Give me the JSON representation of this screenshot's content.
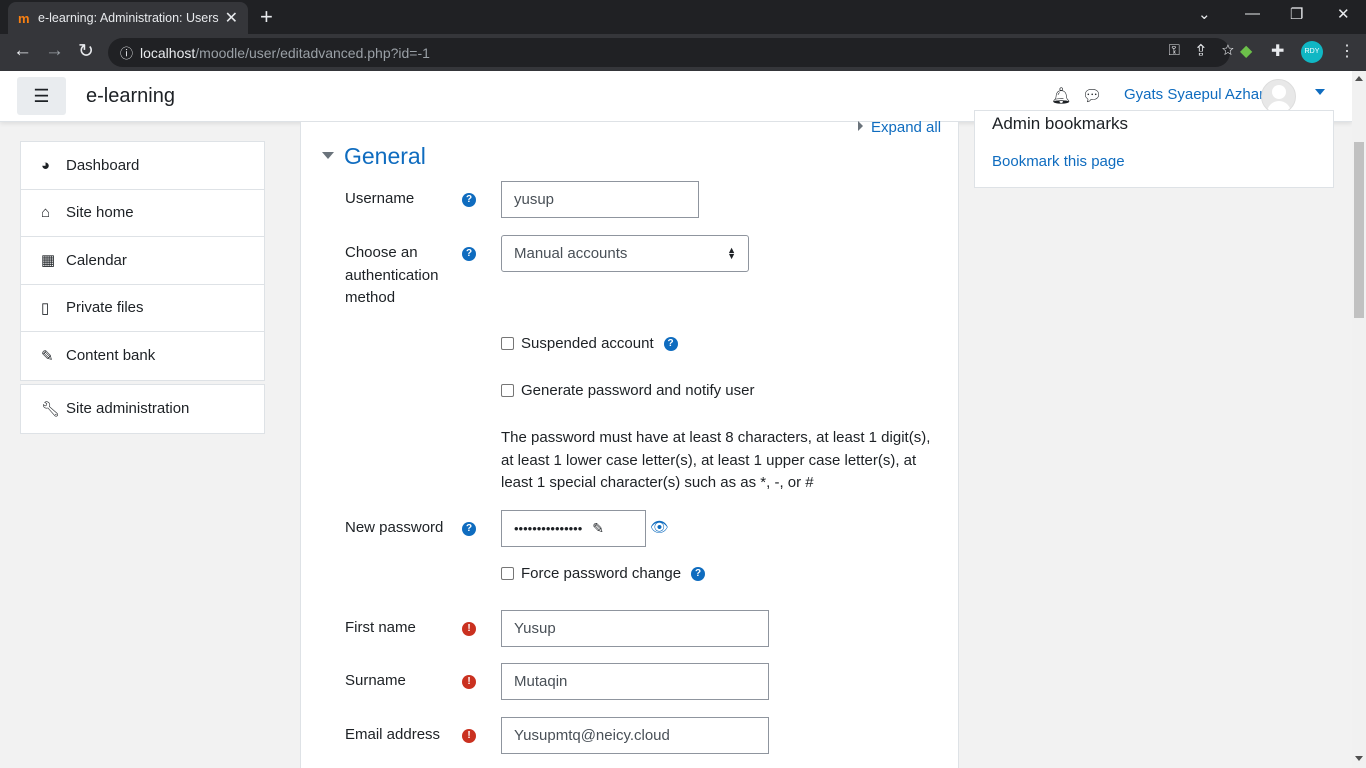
{
  "browser": {
    "tab_title": "e-learning: Administration: Users",
    "tab_favicon": "moodle-icon",
    "url_host": "localhost",
    "url_path": "/moodle/user/editadvanced.php?id=-1",
    "profile_initials": "RDY"
  },
  "navbar": {
    "brand": "e-learning",
    "user_name": "Gyats Syaepul Azhar"
  },
  "drawer": {
    "items": [
      {
        "label": "Dashboard",
        "icon": "dashboard-icon"
      },
      {
        "label": "Site home",
        "icon": "home-icon"
      },
      {
        "label": "Calendar",
        "icon": "calendar-icon"
      },
      {
        "label": "Private files",
        "icon": "file-icon"
      },
      {
        "label": "Content bank",
        "icon": "brush-icon"
      }
    ],
    "admin": {
      "label": "Site administration",
      "icon": "wrench-icon"
    }
  },
  "form": {
    "expand_all": "Expand all",
    "section_title": "General",
    "username": {
      "label": "Username",
      "value": "yusup"
    },
    "auth": {
      "label": "Choose an authentication method",
      "value": "Manual accounts"
    },
    "suspended": {
      "label": "Suspended account",
      "checked": false
    },
    "generate_pw": {
      "label": "Generate password and notify user",
      "checked": false
    },
    "pw_note": "The password must have at least 8 characters, at least 1 digit(s), at least 1 lower case letter(s), at least 1 upper case letter(s), at least 1 special character(s) such as as *, -, or #",
    "new_password": {
      "label": "New password",
      "value": "•••••••••••••••"
    },
    "force_change": {
      "label": "Force password change",
      "checked": false
    },
    "firstname": {
      "label": "First name",
      "value": "Yusup"
    },
    "surname": {
      "label": "Surname",
      "value": "Mutaqin"
    },
    "email": {
      "label": "Email address",
      "value": "Yusupmtq@neicy.cloud"
    }
  },
  "right_block": {
    "title": "Admin bookmarks",
    "link": "Bookmark this page"
  },
  "colors": {
    "link": "#0f6cbf",
    "required": "#ca3120",
    "chrome_dark": "#202124"
  }
}
